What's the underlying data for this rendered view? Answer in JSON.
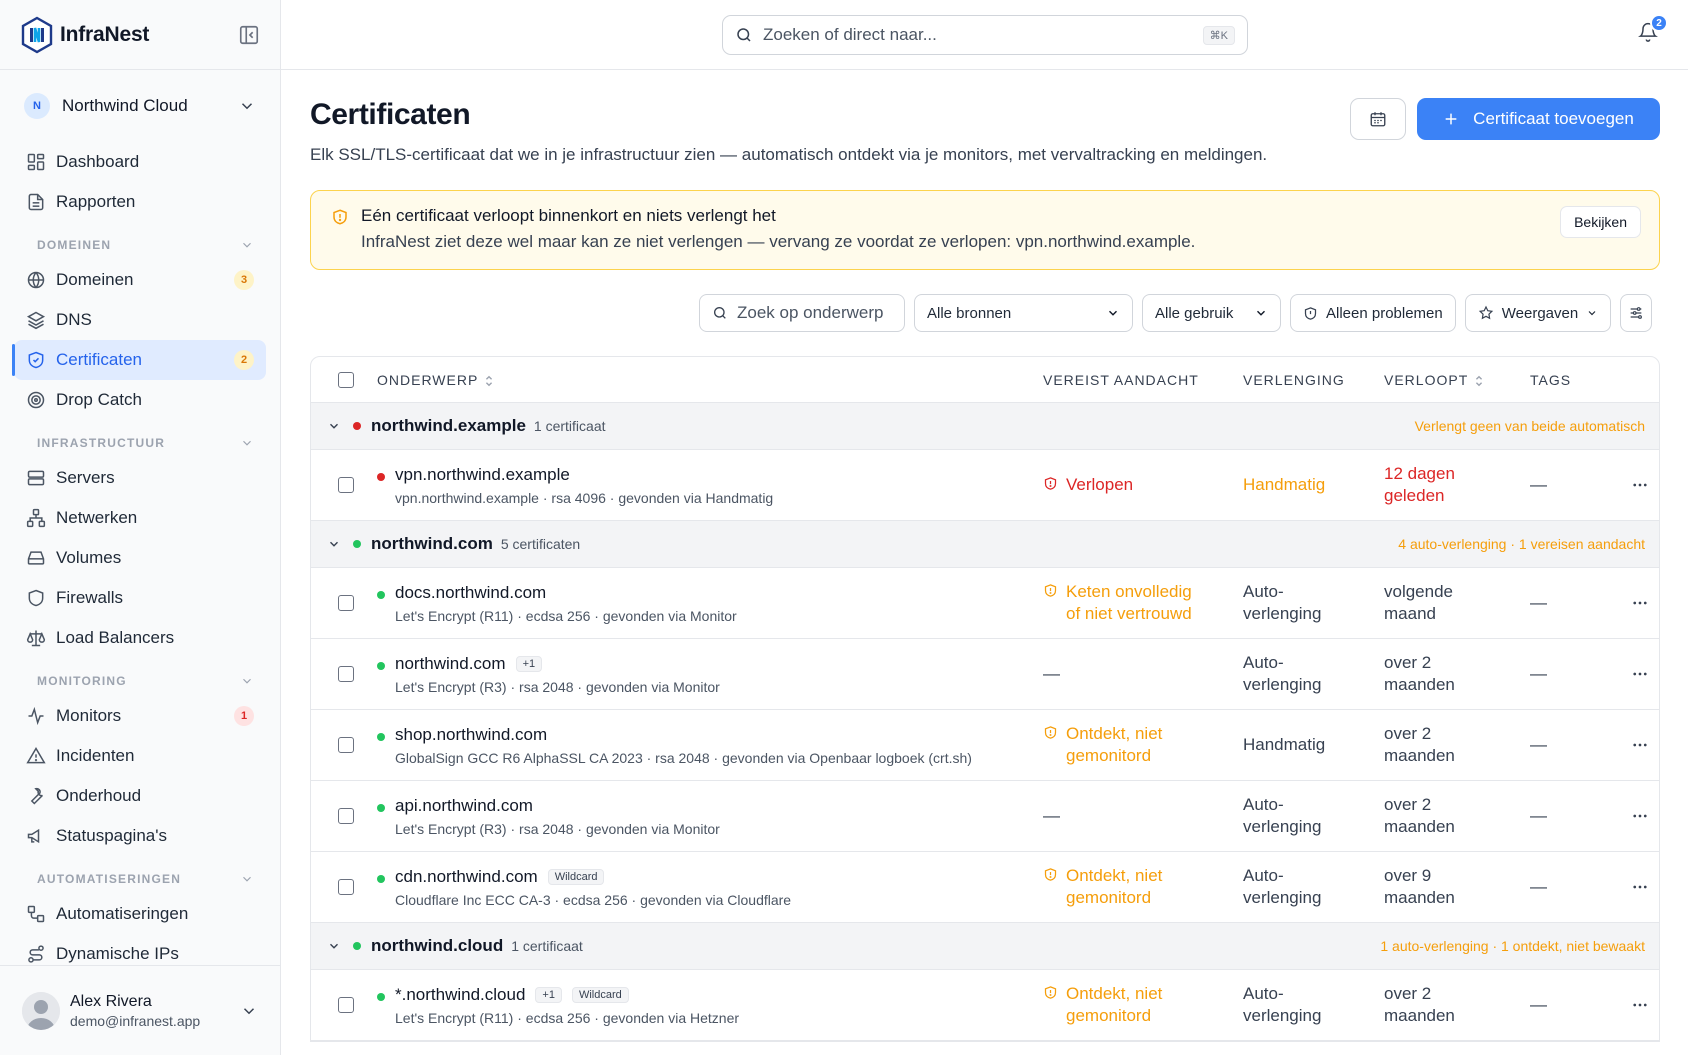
{
  "brand": {
    "name": "InfraNest"
  },
  "org": {
    "initial": "N",
    "name": "Northwind Cloud"
  },
  "nav": {
    "top": [
      {
        "label": "Dashboard",
        "icon": "dashboard-icon"
      },
      {
        "label": "Rapporten",
        "icon": "report-icon"
      }
    ],
    "sections": [
      {
        "title": "DOMEINEN",
        "items": [
          {
            "label": "Domeinen",
            "icon": "globe-icon",
            "count": "3",
            "countColor": "amber"
          },
          {
            "label": "DNS",
            "icon": "layers-icon"
          },
          {
            "label": "Certificaten",
            "icon": "shield-check-icon",
            "count": "2",
            "countColor": "amber",
            "active": true
          },
          {
            "label": "Drop Catch",
            "icon": "target-icon"
          }
        ]
      },
      {
        "title": "INFRASTRUCTUUR",
        "items": [
          {
            "label": "Servers",
            "icon": "server-icon"
          },
          {
            "label": "Netwerken",
            "icon": "network-icon"
          },
          {
            "label": "Volumes",
            "icon": "hard-drive-icon"
          },
          {
            "label": "Firewalls",
            "icon": "shield-icon"
          },
          {
            "label": "Load Balancers",
            "icon": "scale-icon"
          }
        ]
      },
      {
        "title": "MONITORING",
        "items": [
          {
            "label": "Monitors",
            "icon": "activity-icon",
            "count": "1",
            "countColor": "red"
          },
          {
            "label": "Incidenten",
            "icon": "alert-triangle-icon"
          },
          {
            "label": "Onderhoud",
            "icon": "wrench-icon"
          },
          {
            "label": "Statuspagina's",
            "icon": "megaphone-icon"
          }
        ]
      },
      {
        "title": "AUTOMATISERINGEN",
        "items": [
          {
            "label": "Automatiseringen",
            "icon": "workflow-icon"
          },
          {
            "label": "Dynamische IPs",
            "icon": "route-icon"
          }
        ]
      }
    ]
  },
  "user": {
    "name": "Alex Rivera",
    "email": "demo@infranest.app"
  },
  "topbar": {
    "search_placeholder": "Zoeken of direct naar...",
    "shortcut": "⌘K",
    "notifications": "2"
  },
  "page": {
    "title": "Certificaten",
    "subtitle": "Elk SSL/TLS-certificaat dat we in je infrastructuur zien — automatisch ontdekt via je monitors, met vervaltracking en meldingen.",
    "add_label": "Certificaat toevoegen"
  },
  "alert": {
    "heading": "Eén certificaat verloopt binnenkort en niets verlengt het",
    "body": "InfraNest ziet deze wel maar kan ze niet verlengen — vervang ze voordat ze verlopen: vpn.northwind.example.",
    "button": "Bekijken"
  },
  "filters": {
    "search_placeholder": "Zoek op onderwerp",
    "sources": "Alle bronnen",
    "usage": "Alle gebruik",
    "problems": "Alleen problemen",
    "views": "Weergaven"
  },
  "table": {
    "headers": {
      "subject": "ONDERWERP",
      "attention": "VEREIST AANDACHT",
      "renewal": "VERLENGING",
      "expires": "VERLOOPT",
      "tags": "TAGS"
    },
    "groups": [
      {
        "name": "northwind.example",
        "count": "1 certificaat",
        "status": "red",
        "note": "Verlengt geen van beide automatisch",
        "rows": [
          {
            "name": "vpn.northwind.example",
            "meta": "vpn.northwind.example · rsa 4096 · gevonden via Handmatig",
            "status": "red",
            "attention": [
              "Verlopen"
            ],
            "attentionColor": "red",
            "renewal": [
              "Handmatig"
            ],
            "renewalColor": "amber",
            "expires": [
              "12 dagen",
              "geleden"
            ],
            "expiresColor": "red",
            "tags": "—"
          }
        ]
      },
      {
        "name": "northwind.com",
        "count": "5 certificaten",
        "status": "green",
        "note": "4 auto-verlenging · 1 vereisen aandacht",
        "rows": [
          {
            "name": "docs.northwind.com",
            "meta": "Let's Encrypt (R11) · ecdsa 256 · gevonden via Monitor",
            "status": "green",
            "attention": [
              "Keten onvolledig",
              "of niet vertrouwd"
            ],
            "attentionColor": "amber",
            "renewal": [
              "Auto-",
              "verlenging"
            ],
            "expires": [
              "volgende",
              "maand"
            ],
            "tags": "—"
          },
          {
            "name": "northwind.com",
            "badge": "+1",
            "meta": "Let's Encrypt (R3) · rsa 2048 · gevonden via Monitor",
            "status": "green",
            "attention": "—",
            "renewal": [
              "Auto-",
              "verlenging"
            ],
            "expires": [
              "over 2",
              "maanden"
            ],
            "tags": "—"
          },
          {
            "name": "shop.northwind.com",
            "meta": "GlobalSign GCC R6 AlphaSSL CA 2023 · rsa 2048 · gevonden via Openbaar logboek (crt.sh)",
            "status": "green",
            "attention": [
              "Ontdekt, niet",
              "gemonitord"
            ],
            "attentionColor": "amber",
            "renewal": [
              "Handmatig"
            ],
            "expires": [
              "over 2",
              "maanden"
            ],
            "tags": "—"
          },
          {
            "name": "api.northwind.com",
            "meta": "Let's Encrypt (R3) · rsa 2048 · gevonden via Monitor",
            "status": "green",
            "attention": "—",
            "renewal": [
              "Auto-",
              "verlenging"
            ],
            "expires": [
              "over 2",
              "maanden"
            ],
            "tags": "—"
          },
          {
            "name": "cdn.northwind.com",
            "badge": "Wildcard",
            "meta": "Cloudflare Inc ECC CA-3 · ecdsa 256 · gevonden via Cloudflare",
            "status": "green",
            "attention": [
              "Ontdekt, niet",
              "gemonitord"
            ],
            "attentionColor": "amber",
            "renewal": [
              "Auto-",
              "verlenging"
            ],
            "expires": [
              "over 9",
              "maanden"
            ],
            "tags": "—"
          }
        ]
      },
      {
        "name": "northwind.cloud",
        "count": "1 certificaat",
        "status": "green",
        "note": "1 auto-verlenging · 1 ontdekt, niet bewaakt",
        "rows": [
          {
            "name": "*.northwind.cloud",
            "badge": "+1",
            "badge2": "Wildcard",
            "meta": "Let's Encrypt (R11) · ecdsa 256 · gevonden via Hetzner",
            "status": "green",
            "attention": [
              "Ontdekt, niet",
              "gemonitord"
            ],
            "attentionColor": "amber",
            "renewal": [
              "Auto-",
              "verlenging"
            ],
            "expires": [
              "over 2",
              "maanden"
            ],
            "tags": "—"
          }
        ]
      }
    ]
  }
}
